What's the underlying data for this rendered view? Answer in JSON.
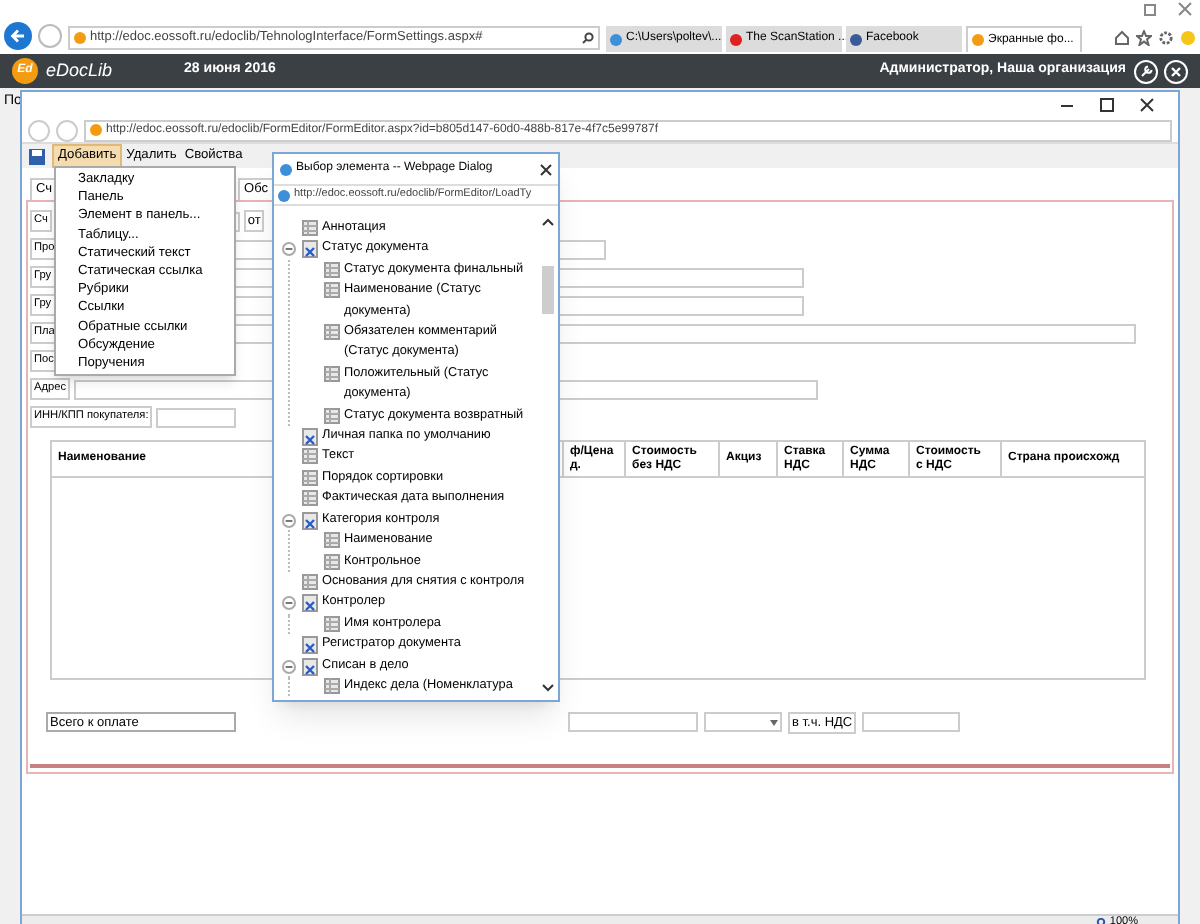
{
  "browser": {
    "address": "http://edoc.eossoft.ru/edoclib/TehnologInterface/FormSettings.aspx#",
    "tabs": [
      {
        "label": "C:\\Users\\poltev\\...",
        "selected": false,
        "kind": "folder"
      },
      {
        "label": "The ScanStation ...",
        "selected": false,
        "kind": "video"
      },
      {
        "label": "Facebook",
        "selected": false,
        "kind": "social"
      },
      {
        "label": "Экранные фо...",
        "selected": true,
        "kind": "app"
      }
    ]
  },
  "app_header": {
    "logo": "Ed",
    "brand": "eDocLib",
    "date": "28 июня 2016",
    "user": "Администратор, Наша организация"
  },
  "background_page": {
    "label": "По"
  },
  "editor_window": {
    "address": "http://edoc.eossoft.ru/edoclib/FormEditor/FormEditor.aspx?id=b805d147-60d0-488b-817e-4f7c5e99787f",
    "toolbar": [
      {
        "label": "Добавить",
        "selected": true
      },
      {
        "label": "Удалить",
        "selected": false
      },
      {
        "label": "Свойства",
        "selected": false
      }
    ],
    "form_tabs": [
      "Сч",
      "Обс"
    ],
    "form_rows": [
      {
        "label": "Сч",
        "extra": "от"
      },
      {
        "label": "Про"
      },
      {
        "label": "Гру"
      },
      {
        "label": "Гру"
      },
      {
        "label": "Пла"
      },
      {
        "label": "Пос"
      },
      {
        "label": "Адрес"
      },
      {
        "label": "ИНН/КПП покупателя:"
      }
    ],
    "table_columns": [
      "Наименование",
      "ф/Цена\nд.",
      "Стоимость\nбез НДС",
      "Акциз",
      "Ставка\nНДС",
      "Сумма\nНДС",
      "Стоимость\nс НДС",
      "Страна происхожд"
    ],
    "total_label": "Всего к оплате",
    "vat_label": "в т.ч. НДС",
    "zoom": "100%"
  },
  "add_menu": [
    "Закладку",
    "Панель",
    "Элемент в панель...",
    "Таблицу...",
    "Статический текст",
    "Статическая ссылка",
    "Рубрики",
    "Ссылки",
    "Обратные ссылки",
    "Обсуждение",
    "Поручения"
  ],
  "dialog": {
    "title": "Выбор элемента -- Webpage Dialog",
    "address": "http://edoc.eossoft.ru/edoclib/FormEditor/LoadTy",
    "tree": [
      {
        "label": "Аннотация",
        "kind": "field"
      },
      {
        "label": "Статус документа",
        "kind": "group",
        "expanded": true,
        "children": [
          {
            "label": "Статус документа финальный",
            "kind": "field"
          },
          {
            "label": "Наименование (Статус документа)",
            "kind": "field"
          },
          {
            "label": "Обязателен комментарий (Статус документа)",
            "kind": "field"
          },
          {
            "label": "Положительный (Статус документа)",
            "kind": "field"
          },
          {
            "label": "Статус документа возвратный",
            "kind": "field"
          }
        ]
      },
      {
        "label": "Личная папка по умолчанию",
        "kind": "group",
        "expanded": false
      },
      {
        "label": "Текст",
        "kind": "field"
      },
      {
        "label": "Порядок сортировки",
        "kind": "field"
      },
      {
        "label": "Фактическая дата выполнения",
        "kind": "field"
      },
      {
        "label": "Категория контроля",
        "kind": "group",
        "expanded": true,
        "children": [
          {
            "label": "Наименование",
            "kind": "field"
          },
          {
            "label": "Контрольное",
            "kind": "field"
          }
        ]
      },
      {
        "label": "Основания для снятия с контроля",
        "kind": "field"
      },
      {
        "label": "Контролер",
        "kind": "group",
        "expanded": true,
        "children": [
          {
            "label": "Имя контролера",
            "kind": "field"
          }
        ]
      },
      {
        "label": "Регистратор документа",
        "kind": "group",
        "expanded": false
      },
      {
        "label": "Списан в дело",
        "kind": "group",
        "expanded": true,
        "children": [
          {
            "label": "Индекс дела (Номенклатура",
            "kind": "field"
          }
        ]
      }
    ]
  }
}
